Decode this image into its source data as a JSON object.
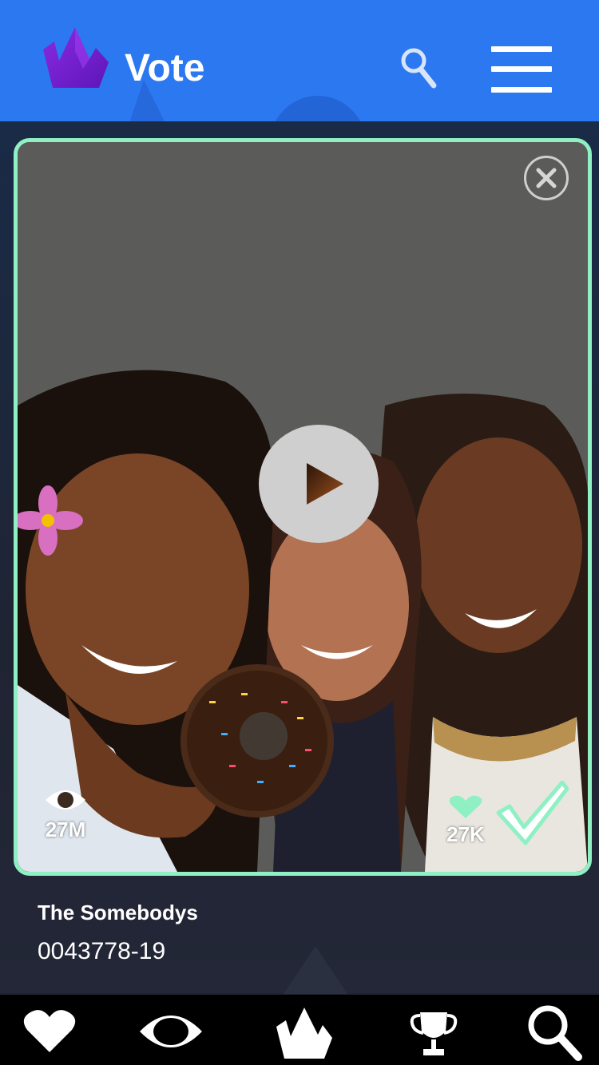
{
  "header": {
    "title": "Vote",
    "logo_icon": "crown-logo-icon",
    "search_icon": "search-icon",
    "menu_icon": "hamburger-menu-icon"
  },
  "card": {
    "close_icon": "close-icon",
    "play_icon": "play-icon",
    "views_icon": "eye-icon",
    "views": "27M",
    "likes_icon": "heart-icon",
    "likes": "27K",
    "vote_icon": "checkmark-icon"
  },
  "entry": {
    "name": "The Somebodys",
    "id": "0043778-19"
  },
  "nav": {
    "items": [
      {
        "icon": "heart-icon"
      },
      {
        "icon": "eye-icon"
      },
      {
        "icon": "crown-logo-icon"
      },
      {
        "icon": "trophy-icon"
      },
      {
        "icon": "search-icon"
      }
    ]
  },
  "colors": {
    "header_bg": "#2b78f1",
    "card_border": "#8ff0c4",
    "logo_purple": "#7a22d6",
    "nav_bg": "#000000",
    "page_bg": "#1f2433"
  }
}
